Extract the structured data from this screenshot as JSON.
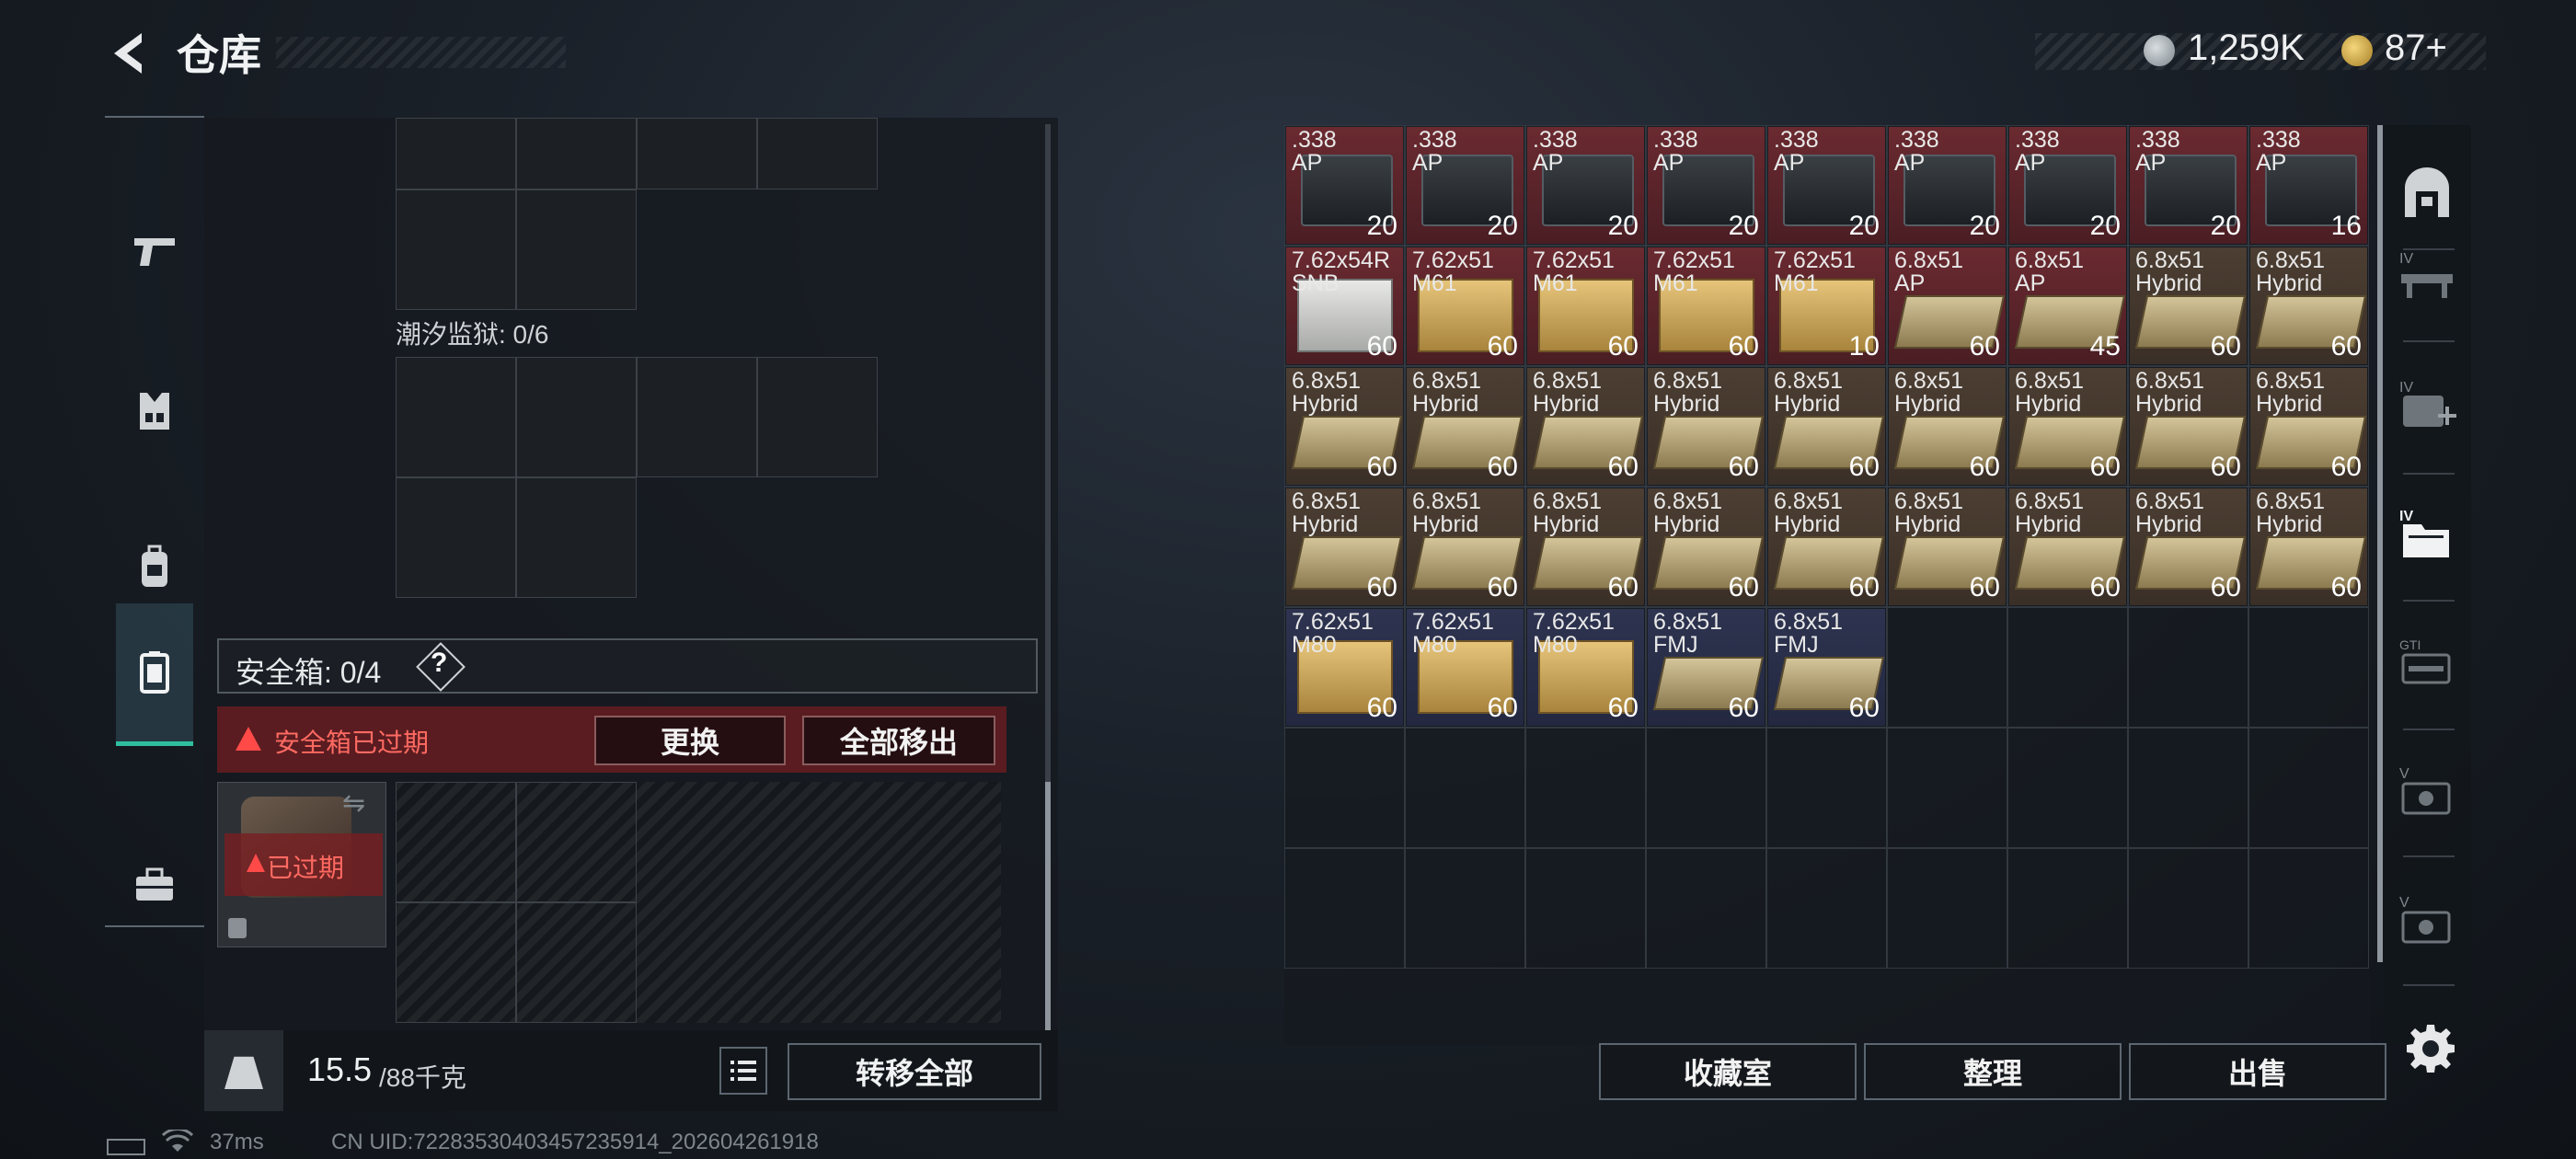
{
  "header": {
    "title": "仓库",
    "currency": {
      "silver": "1,259K",
      "gold": "87+"
    }
  },
  "left_nav": {
    "items": [
      {
        "icon": "gun-icon"
      },
      {
        "icon": "vest-icon"
      },
      {
        "icon": "backpack-icon"
      },
      {
        "icon": "container-icon",
        "active": true
      },
      {
        "icon": "toolbox-icon"
      }
    ]
  },
  "storage": {
    "prison_label": "潮汐监狱: 0/6",
    "safebox_label": "安全箱: 0/4",
    "help_glyph": "?",
    "expired_warning": "安全箱已过期",
    "replace_label": "更换",
    "remove_all_label": "全部移出",
    "case_status": "已过期",
    "weight_current": "15.5",
    "weight_max": "/88千克",
    "transfer_all_label": "转移全部"
  },
  "status": {
    "ping": "37ms",
    "uid": "CN UID:72283530403457235914_202604261918"
  },
  "items": [
    {
      "name": ".338\nAP",
      "qty": "20",
      "color": "red",
      "art": "case"
    },
    {
      "name": ".338\nAP",
      "qty": "20",
      "color": "red",
      "art": "case"
    },
    {
      "name": ".338\nAP",
      "qty": "20",
      "color": "red",
      "art": "case"
    },
    {
      "name": ".338\nAP",
      "qty": "20",
      "color": "red",
      "art": "case"
    },
    {
      "name": ".338\nAP",
      "qty": "20",
      "color": "red",
      "art": "case"
    },
    {
      "name": ".338\nAP",
      "qty": "20",
      "color": "red",
      "art": "case"
    },
    {
      "name": ".338\nAP",
      "qty": "20",
      "color": "red",
      "art": "case"
    },
    {
      "name": ".338\nAP",
      "qty": "20",
      "color": "red",
      "art": "case"
    },
    {
      "name": ".338\nAP",
      "qty": "16",
      "color": "red",
      "art": "case"
    },
    {
      "name": "7.62x54R\nSNB",
      "qty": "60",
      "color": "red",
      "art": "box-white"
    },
    {
      "name": "7.62x51\nM61",
      "qty": "60",
      "color": "red",
      "art": "box-gold"
    },
    {
      "name": "7.62x51\nM61",
      "qty": "60",
      "color": "red",
      "art": "box-gold"
    },
    {
      "name": "7.62x51\nM61",
      "qty": "60",
      "color": "red",
      "art": "box-gold"
    },
    {
      "name": "7.62x51\nM61",
      "qty": "10",
      "color": "red",
      "art": "box-gold"
    },
    {
      "name": "6.8x51\nAP",
      "qty": "60",
      "color": "red",
      "art": "box-flat"
    },
    {
      "name": "6.8x51\nAP",
      "qty": "45",
      "color": "red",
      "art": "box-flat"
    },
    {
      "name": "6.8x51\nHybrid",
      "qty": "60",
      "color": "tan",
      "art": "box-flat"
    },
    {
      "name": "6.8x51\nHybrid",
      "qty": "60",
      "color": "tan",
      "art": "box-flat"
    },
    {
      "name": "6.8x51\nHybrid",
      "qty": "60",
      "color": "tan",
      "art": "box-flat"
    },
    {
      "name": "6.8x51\nHybrid",
      "qty": "60",
      "color": "tan",
      "art": "box-flat"
    },
    {
      "name": "6.8x51\nHybrid",
      "qty": "60",
      "color": "tan",
      "art": "box-flat"
    },
    {
      "name": "6.8x51\nHybrid",
      "qty": "60",
      "color": "tan",
      "art": "box-flat"
    },
    {
      "name": "6.8x51\nHybrid",
      "qty": "60",
      "color": "tan",
      "art": "box-flat"
    },
    {
      "name": "6.8x51\nHybrid",
      "qty": "60",
      "color": "tan",
      "art": "box-flat"
    },
    {
      "name": "6.8x51\nHybrid",
      "qty": "60",
      "color": "tan",
      "art": "box-flat"
    },
    {
      "name": "6.8x51\nHybrid",
      "qty": "60",
      "color": "tan",
      "art": "box-flat"
    },
    {
      "name": "6.8x51\nHybrid",
      "qty": "60",
      "color": "tan",
      "art": "box-flat"
    },
    {
      "name": "6.8x51\nHybrid",
      "qty": "60",
      "color": "tan",
      "art": "box-flat"
    },
    {
      "name": "6.8x51\nHybrid",
      "qty": "60",
      "color": "tan",
      "art": "box-flat"
    },
    {
      "name": "6.8x51\nHybrid",
      "qty": "60",
      "color": "tan",
      "art": "box-flat"
    },
    {
      "name": "6.8x51\nHybrid",
      "qty": "60",
      "color": "tan",
      "art": "box-flat"
    },
    {
      "name": "6.8x51\nHybrid",
      "qty": "60",
      "color": "tan",
      "art": "box-flat"
    },
    {
      "name": "6.8x51\nHybrid",
      "qty": "60",
      "color": "tan",
      "art": "box-flat"
    },
    {
      "name": "6.8x51\nHybrid",
      "qty": "60",
      "color": "tan",
      "art": "box-flat"
    },
    {
      "name": "6.8x51\nHybrid",
      "qty": "60",
      "color": "tan",
      "art": "box-flat"
    },
    {
      "name": "6.8x51\nHybrid",
      "qty": "60",
      "color": "tan",
      "art": "box-flat"
    },
    {
      "name": "7.62x51\nM80",
      "qty": "60",
      "color": "blue",
      "art": "box-gold"
    },
    {
      "name": "7.62x51\nM80",
      "qty": "60",
      "color": "blue",
      "art": "box-gold"
    },
    {
      "name": "7.62x51\nM80",
      "qty": "60",
      "color": "blue",
      "art": "box-gold"
    },
    {
      "name": "6.8x51\nFMJ",
      "qty": "60",
      "color": "blue",
      "art": "box-flat"
    },
    {
      "name": "6.8x51\nFMJ",
      "qty": "60",
      "color": "blue",
      "art": "box-flat"
    }
  ],
  "grid": {
    "total_cells": 63
  },
  "right_nav": {
    "items": [
      {
        "icon": "safehouse-icon"
      },
      {
        "icon": "workbench-iv-icon",
        "level": "IV"
      },
      {
        "icon": "medical-station-iv-icon",
        "level": "IV"
      },
      {
        "icon": "storage-iv-icon",
        "level": "IV",
        "active": true
      },
      {
        "icon": "gti-armory-icon",
        "level": "GTI"
      },
      {
        "icon": "tech-center-v-icon",
        "level": "V"
      },
      {
        "icon": "tech-center-v2-icon",
        "level": "V"
      }
    ]
  },
  "actions": {
    "collection_label": "收藏室",
    "sort_label": "整理",
    "sell_label": "出售"
  },
  "colors": {
    "item_red": "#5a242a",
    "item_tan": "#43372d",
    "item_blue": "#282e48",
    "accent_teal": "#2fbfa0",
    "warning_red": "#ff4a48"
  }
}
